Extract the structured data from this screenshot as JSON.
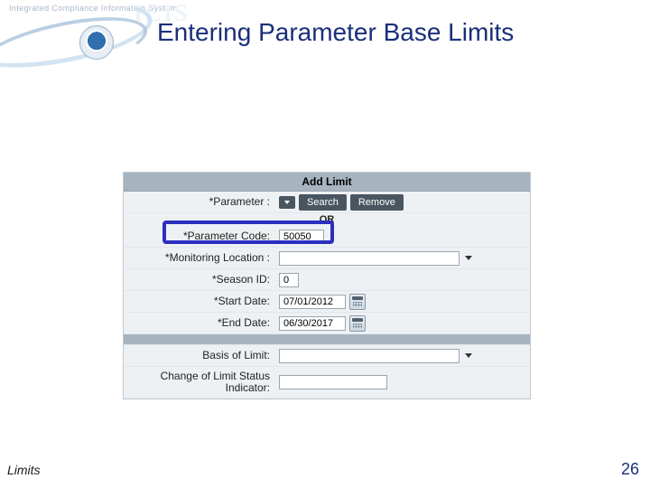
{
  "branding": {
    "system_tagline": "Integrated Compliance Information System",
    "watermark": "ICIS"
  },
  "page_title": "Entering Parameter Base Limits",
  "form": {
    "header": "Add Limit",
    "parameter_row_label": "*Parameter :",
    "search_button": "Search",
    "remove_button": "Remove",
    "or_text": "OR",
    "parameter_code_label": "*Parameter Code:",
    "parameter_code_value": "50050",
    "monitoring_location_label": "*Monitoring Location :",
    "monitoring_location_value": "",
    "season_id_label": "*Season ID:",
    "season_id_value": "0",
    "start_date_label": "*Start Date:",
    "start_date_value": "07/01/2012",
    "end_date_label": "*End Date:",
    "end_date_value": "06/30/2017",
    "basis_label": "Basis of Limit:",
    "basis_value": "",
    "change_indicator_label": "Change of Limit Status Indicator:",
    "change_indicator_value": ""
  },
  "footer": {
    "section": "Limits",
    "page_number": "26"
  }
}
